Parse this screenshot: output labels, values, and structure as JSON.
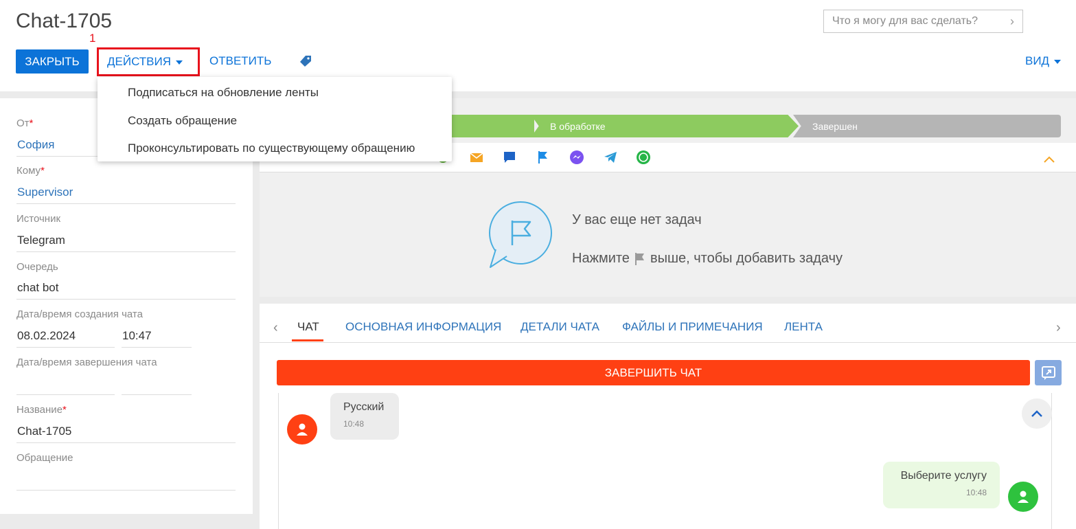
{
  "header": {
    "title": "Chat-1705",
    "help_placeholder": "Что я могу для вас сделать?",
    "close_label": "ЗАКРЫТЬ",
    "actions_label": "ДЕЙСТВИЯ",
    "reply_label": "ОТВЕТИТЬ",
    "view_label": "ВИД",
    "annotation_marker": "1"
  },
  "actions_menu": {
    "items": [
      "Подписаться на обновление ленты",
      "Создать обращение",
      "Проконсультировать по существующему обращению"
    ]
  },
  "fields": {
    "from": {
      "label": "От",
      "value": "София"
    },
    "to": {
      "label": "Кому",
      "value": "Supervisor"
    },
    "source": {
      "label": "Источник",
      "value": "Telegram"
    },
    "queue": {
      "label": "Очередь",
      "value": "chat bot"
    },
    "created": {
      "label": "Дата/время создания чата",
      "date": "08.02.2024",
      "time": "10:47"
    },
    "finished": {
      "label": "Дата/время завершения чата",
      "date": "",
      "time": ""
    },
    "name": {
      "label": "Название",
      "value": "Chat-1705"
    },
    "case": {
      "label": "Обращение",
      "value": ""
    }
  },
  "stages": [
    {
      "label": "",
      "color": "#8dcb5f"
    },
    {
      "label": "В обработке",
      "color": "#8dcb5f"
    },
    {
      "label": "Завершен",
      "color": "#b5b5b5"
    }
  ],
  "tasks": {
    "empty_title": "У вас еще нет задач",
    "hint_before": "Нажмите",
    "hint_after": "выше, чтобы добавить задачу"
  },
  "chat_tabs": [
    "ЧАТ",
    "ОСНОВНАЯ ИНФОРМАЦИЯ",
    "ДЕТАЛИ ЧАТА",
    "ФАЙЛЫ И ПРИМЕЧАНИЯ",
    "ЛЕНТА"
  ],
  "end_chat_label": "ЗАВЕРШИТЬ ЧАТ",
  "messages": [
    {
      "text": "Русский",
      "time": "10:48",
      "side": "left"
    },
    {
      "text": "Выберите услугу",
      "time": "10:48",
      "side": "right"
    }
  ],
  "colors": {
    "primary": "#0c73d8",
    "end_chat": "#ff4013",
    "highlight": "#e8121c",
    "stage_done": "#8dcb5f",
    "stage_pending": "#b5b5b5"
  }
}
